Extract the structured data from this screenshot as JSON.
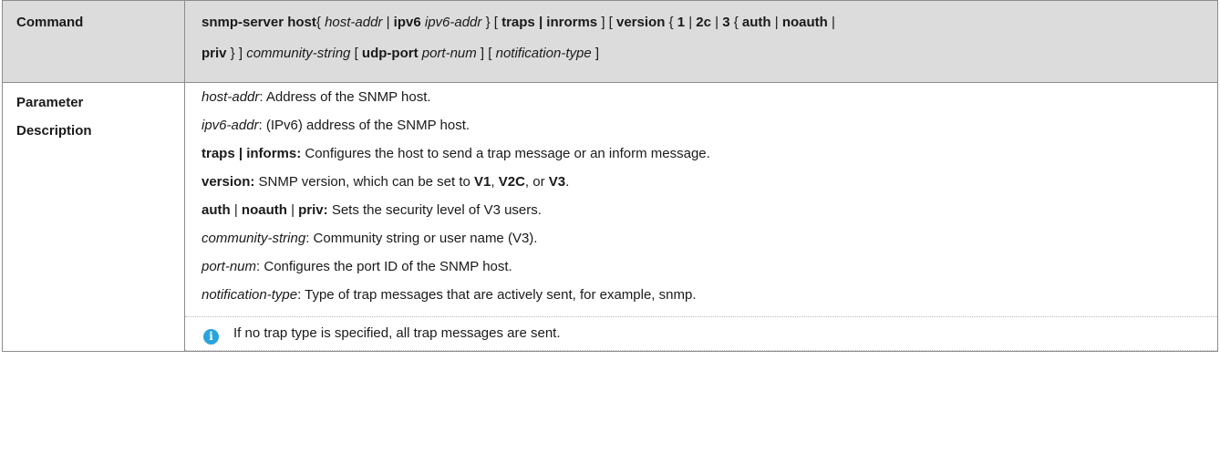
{
  "command_row": {
    "label": "Command",
    "line1": [
      {
        "t": "snmp-server host",
        "s": "b"
      },
      {
        "t": "{ ",
        "s": ""
      },
      {
        "t": "host-addr",
        "s": "i"
      },
      {
        "t": " | ",
        "s": ""
      },
      {
        "t": "ipv6",
        "s": "b"
      },
      {
        "t": " ",
        "s": ""
      },
      {
        "t": "ipv6-addr",
        "s": "i"
      },
      {
        "t": " } [ ",
        "s": ""
      },
      {
        "t": "traps | inrorms",
        "s": "b"
      },
      {
        "t": " ] [ ",
        "s": ""
      },
      {
        "t": "version",
        "s": "b"
      },
      {
        "t": " { ",
        "s": ""
      },
      {
        "t": "1",
        "s": "b"
      },
      {
        "t": " | ",
        "s": ""
      },
      {
        "t": "2c",
        "s": "b"
      },
      {
        "t": " | ",
        "s": ""
      },
      {
        "t": "3",
        "s": "b"
      },
      {
        "t": " { ",
        "s": ""
      },
      {
        "t": "auth",
        "s": "b"
      },
      {
        "t": " | ",
        "s": ""
      },
      {
        "t": "noauth",
        "s": "b"
      },
      {
        "t": " |",
        "s": ""
      }
    ],
    "line2": [
      {
        "t": "priv",
        "s": "b"
      },
      {
        "t": " } ] ",
        "s": ""
      },
      {
        "t": "community-string",
        "s": "i"
      },
      {
        "t": " [ ",
        "s": ""
      },
      {
        "t": "udp-port",
        "s": "b"
      },
      {
        "t": " ",
        "s": ""
      },
      {
        "t": "port-num",
        "s": "i"
      },
      {
        "t": " ] [ ",
        "s": ""
      },
      {
        "t": "notification-type",
        "s": "i"
      },
      {
        "t": " ]",
        "s": ""
      }
    ]
  },
  "param_row": {
    "label_line1": "Parameter",
    "label_line2": "Description",
    "lines": [
      [
        {
          "t": "host-addr",
          "s": "i"
        },
        {
          "t": ": Address of the SNMP host.",
          "s": ""
        }
      ],
      [
        {
          "t": "ipv6-addr",
          "s": "i"
        },
        {
          "t": ": (IPv6) address of the SNMP host.",
          "s": ""
        }
      ],
      [
        {
          "t": "traps | informs:",
          "s": "b"
        },
        {
          "t": " Configures the host to send a trap message or an inform message.",
          "s": ""
        }
      ],
      [
        {
          "t": "version:",
          "s": "b"
        },
        {
          "t": " SNMP version, which can be set to ",
          "s": ""
        },
        {
          "t": "V1",
          "s": "b"
        },
        {
          "t": ", ",
          "s": ""
        },
        {
          "t": "V2C",
          "s": "b"
        },
        {
          "t": ", or ",
          "s": ""
        },
        {
          "t": "V3",
          "s": "b"
        },
        {
          "t": ".",
          "s": ""
        }
      ],
      [
        {
          "t": "auth",
          "s": "b"
        },
        {
          "t": " | ",
          "s": ""
        },
        {
          "t": "noauth",
          "s": "b"
        },
        {
          "t": " | ",
          "s": ""
        },
        {
          "t": "priv:",
          "s": "b"
        },
        {
          "t": " Sets the security level of V3 users.",
          "s": ""
        }
      ],
      [
        {
          "t": "community-string",
          "s": "i"
        },
        {
          "t": ": Community string or user name (V3).",
          "s": ""
        }
      ],
      [
        {
          "t": "port-num",
          "s": "i"
        },
        {
          "t": ": Configures the port ID of the SNMP host.",
          "s": ""
        }
      ],
      [
        {
          "t": "notification-type",
          "s": "i"
        },
        {
          "t": ": Type of trap messages that are actively sent, for example, snmp.",
          "s": ""
        }
      ]
    ],
    "note": {
      "icon": "info-icon",
      "text": "If no trap type is specified, all trap messages are sent."
    }
  },
  "colors": {
    "header_bg": "#dcdcdc",
    "border": "#8c8c8c",
    "info_icon": "#2aa3dc"
  }
}
